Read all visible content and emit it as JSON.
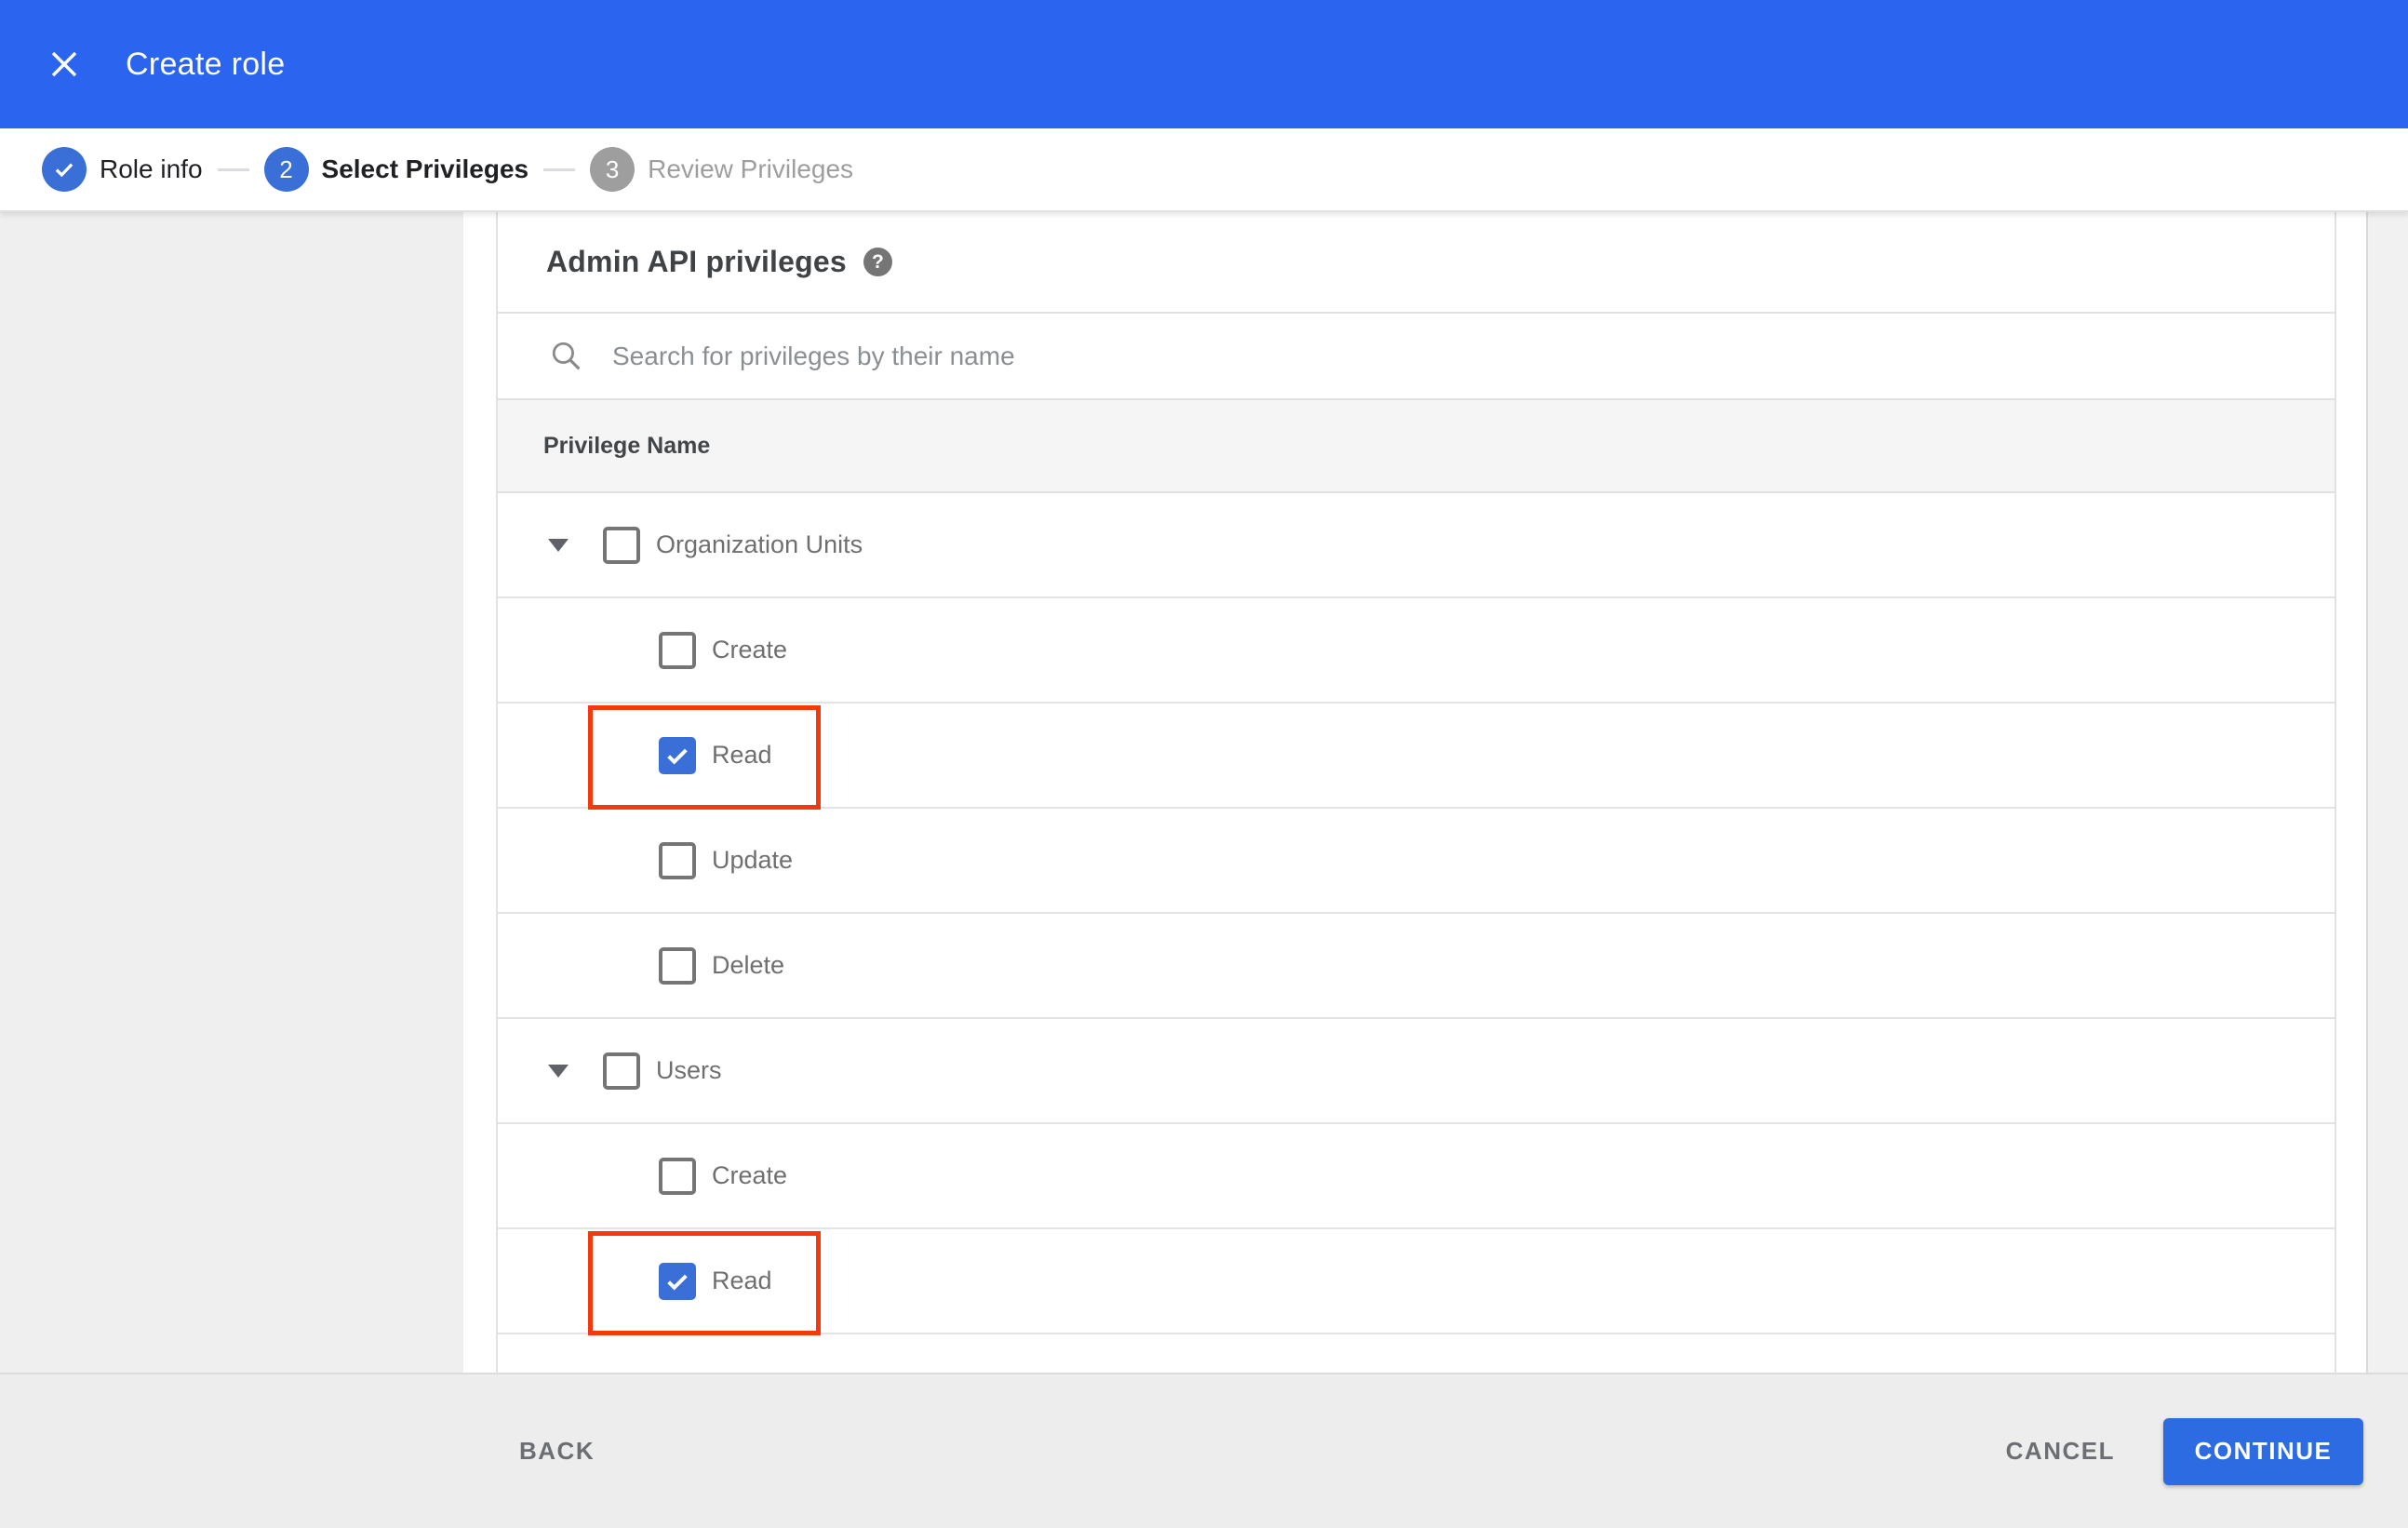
{
  "topbar": {
    "title": "Create role"
  },
  "stepper": {
    "steps": [
      {
        "label": "Role info",
        "state": "done",
        "glyph": "check"
      },
      {
        "label": "Select Privileges",
        "state": "active",
        "glyph": "2"
      },
      {
        "label": "Review Privileges",
        "state": "upcoming",
        "glyph": "3"
      }
    ]
  },
  "content": {
    "heading": "Admin API privileges",
    "help_glyph": "?",
    "search_placeholder": "Search for privileges by their name",
    "table_header": "Privilege Name",
    "rows": [
      {
        "label": "Organization Units",
        "type": "parent",
        "checked": false,
        "highlighted": false
      },
      {
        "label": "Create",
        "type": "child",
        "checked": false,
        "highlighted": false
      },
      {
        "label": "Read",
        "type": "child",
        "checked": true,
        "highlighted": true
      },
      {
        "label": "Update",
        "type": "child",
        "checked": false,
        "highlighted": false
      },
      {
        "label": "Delete",
        "type": "child",
        "checked": false,
        "highlighted": false
      },
      {
        "label": "Users",
        "type": "parent",
        "checked": false,
        "highlighted": false
      },
      {
        "label": "Create",
        "type": "child",
        "checked": false,
        "highlighted": false
      },
      {
        "label": "Read",
        "type": "child",
        "checked": true,
        "highlighted": true
      }
    ]
  },
  "footer": {
    "back": "BACK",
    "cancel": "CANCEL",
    "continue": "CONTINUE"
  },
  "colors": {
    "topbar_blue": "#2b64ef",
    "step_blue": "#3a6fd8",
    "checkbox_blue": "#3a6fd8",
    "continue_blue": "#2d6be2",
    "highlight_red": "#f4380f",
    "header_band_gray": "#f5f5f5",
    "footer_gray": "#ededed"
  }
}
